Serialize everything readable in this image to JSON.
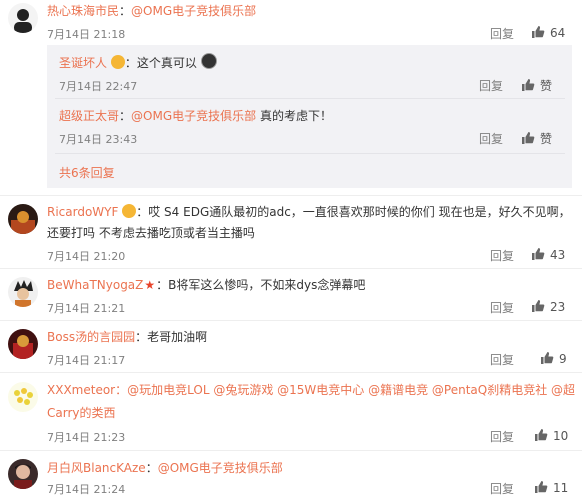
{
  "comments": [
    {
      "username": "热心珠海市民",
      "colon": "：",
      "text": "@OMG电子竞技俱乐部",
      "time": "7月14日 21:18",
      "reply": "回复",
      "likes": "64"
    },
    {
      "username": "RicardoWYF",
      "text_line1_a": "：哎 S4 EDG通队最初的adc，一直很喜欢那时候的你们 现在也是，好久不见啊，",
      "text_line2": "还要打吗 不考虑去播吃顶或者当主播吗",
      "time": "7月14日 21:20",
      "reply": "回复",
      "likes": "43"
    },
    {
      "username": "BeWhaTNyogaZ",
      "text": "：B将军这么惨吗，不如来dys念弹幕吧",
      "time": "7月14日 21:21",
      "reply": "回复",
      "likes": "23"
    },
    {
      "username": "Boss汤的言园园",
      "text": "：老哥加油啊",
      "time": "7月14日 21:17",
      "reply": "回复",
      "likes": "9"
    },
    {
      "username": "XXXmeteor",
      "text_line1": "：@玩加电竞LOL @兔玩游戏 @15W电竞中心 @籍谱电竞 @PentaQ刹精电竞社 @超",
      "text_line2": "Carry的类西",
      "time": "7月14日 21:23",
      "reply": "回复",
      "likes": "10"
    },
    {
      "username": "月白风BlancKAze",
      "colon": "：",
      "text": "@OMG电子竞技俱乐部",
      "time": "7月14日 21:24",
      "reply": "回复",
      "likes": "11"
    }
  ],
  "subreplies": [
    {
      "username": "圣诞坏人",
      "text": "：这个真可以",
      "time": "7月14日 22:47",
      "reply": "回复",
      "like_label": "赞"
    },
    {
      "username": "超级正太哥",
      "colon": "：",
      "mention": "@OMG电子竞技俱乐部",
      "text": " 真的考虑下！",
      "time": "7月14日 23:43",
      "reply": "回复",
      "like_label": "赞"
    }
  ],
  "more_replies": "共6条回复",
  "colors": {
    "accent": "#eb7350",
    "muted": "#808080",
    "subbox_bg": "#f2f2f5"
  },
  "icons": [
    "thumbs-up-icon",
    "vip-badge-icon",
    "star-badge-icon"
  ]
}
